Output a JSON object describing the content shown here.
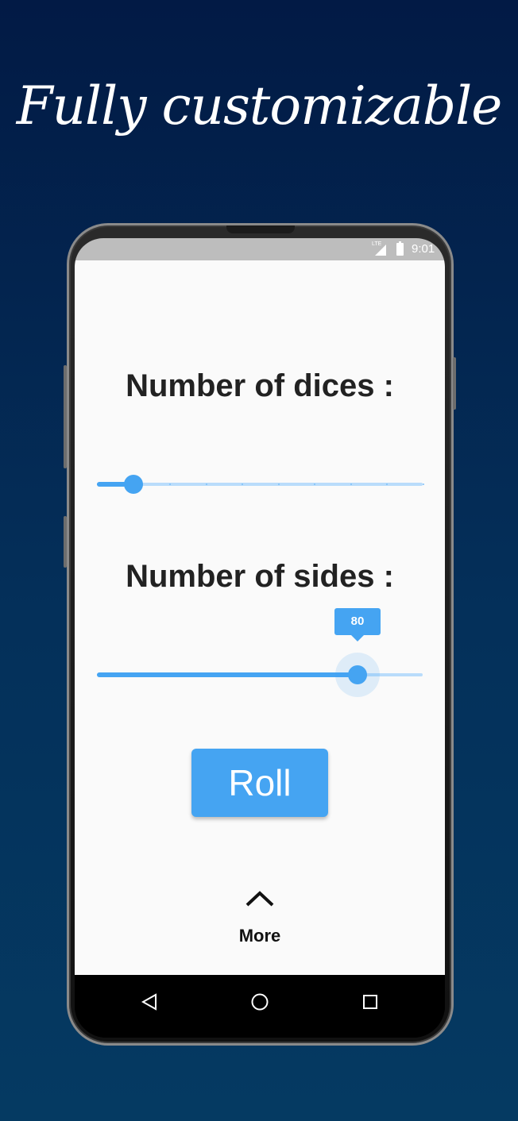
{
  "headline": "Fully customizable",
  "status_bar": {
    "network": "LTE",
    "time": "9:01"
  },
  "dice_section": {
    "label": "Number of dices :",
    "slider": {
      "fraction": 0.111,
      "divisions": 9
    }
  },
  "sides_section": {
    "label": "Number of sides :",
    "slider": {
      "value_label": "80",
      "fraction": 0.8
    }
  },
  "roll_button": {
    "label": "Roll"
  },
  "more": {
    "label": "More",
    "icon": "chevron-up-icon"
  },
  "nav_bar": {
    "icons": [
      "back-icon",
      "home-icon",
      "recents-icon"
    ]
  },
  "colors": {
    "accent": "#45a4f2",
    "track_light": "#b9dcfb",
    "background": "#021a45"
  }
}
